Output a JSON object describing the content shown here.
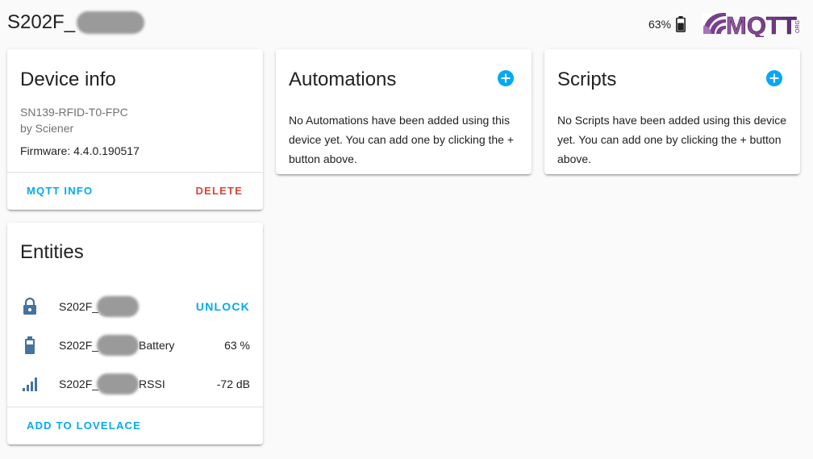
{
  "header": {
    "title": "S202F_",
    "battery_text": "63%",
    "logo_text": "MQTT",
    "logo_sub": "ORG"
  },
  "device_info": {
    "title": "Device info",
    "model": "SN139-RFID-T0-FPC",
    "manufacturer": "by Sciener",
    "firmware": "Firmware: 4.4.0.190517",
    "mqtt_info_label": "MQTT INFO",
    "delete_label": "DELETE"
  },
  "automations": {
    "title": "Automations",
    "message": "No Automations have been added using this device yet. You can add one by clicking the + button above."
  },
  "scripts": {
    "title": "Scripts",
    "message": "No Scripts have been added using this device yet. You can add one by clicking the + button above."
  },
  "entities": {
    "title": "Entities",
    "rows": [
      {
        "icon": "lock-icon",
        "name_prefix": "S202F_",
        "name_suffix": "",
        "state": "UNLOCK"
      },
      {
        "icon": "battery-icon",
        "name_prefix": "S202F_",
        "name_suffix": "Battery",
        "state": "63 %"
      },
      {
        "icon": "signal-icon",
        "name_prefix": "S202F_",
        "name_suffix": "RSSI",
        "state": "-72 dB"
      }
    ],
    "add_to_lovelace_label": "ADD TO LOVELACE"
  },
  "colors": {
    "accent": "#03a9f4",
    "delete": "#db4437",
    "icon": "#44739e"
  }
}
